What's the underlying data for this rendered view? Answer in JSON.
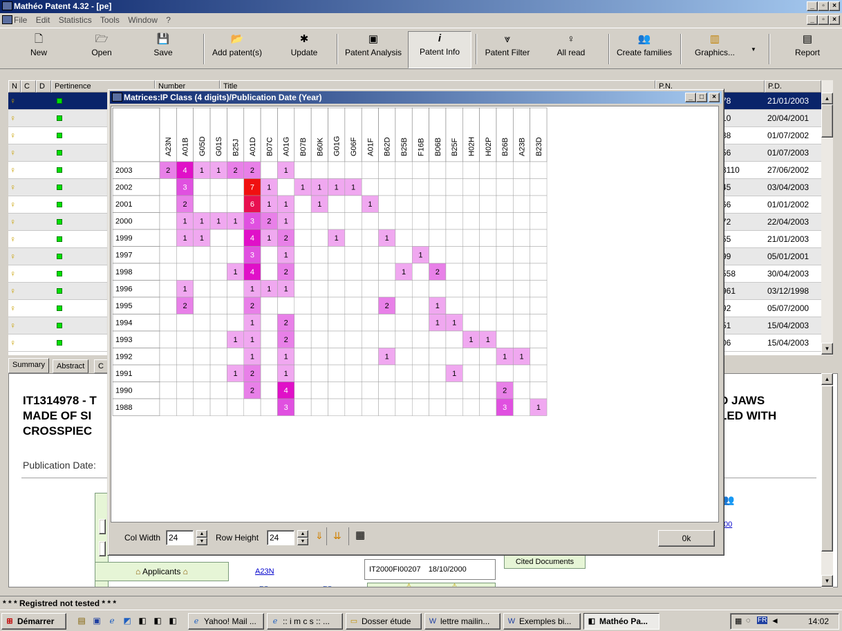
{
  "window": {
    "title": "Mathéo Patent 4.32 - [pe]"
  },
  "menu": [
    "File",
    "Edit",
    "Statistics",
    "Tools",
    "Window",
    "?"
  ],
  "toolbar": [
    {
      "label": "New",
      "icon": "new-file-icon",
      "glyph": "🗋"
    },
    {
      "label": "Open",
      "icon": "open-folder-icon",
      "glyph": "🗁"
    },
    {
      "label": "Save",
      "icon": "save-disk-icon",
      "glyph": "💾"
    },
    {
      "label": "Add patent(s)",
      "icon": "add-patent-icon",
      "glyph": "📂"
    },
    {
      "label": "Update",
      "icon": "update-icon",
      "glyph": "✱"
    },
    {
      "label": "Patent Analysis",
      "icon": "patent-analysis-icon",
      "glyph": "▣"
    },
    {
      "label": "Patent Info",
      "icon": "info-icon",
      "glyph": "i"
    },
    {
      "label": "Patent Filter",
      "icon": "filter-icon",
      "glyph": "⩔"
    },
    {
      "label": "All read",
      "icon": "bulb-icon",
      "glyph": "♀"
    },
    {
      "label": "Create families",
      "icon": "families-icon",
      "glyph": "👥"
    },
    {
      "label": "Graphics...",
      "icon": "chart-icon",
      "glyph": "▥"
    },
    {
      "label": "Report",
      "icon": "report-icon",
      "glyph": "▤"
    }
  ],
  "list": {
    "headers": [
      "N",
      "C",
      "D",
      "Pertinence",
      "Number",
      "Title",
      "P.N.",
      "P.D."
    ],
    "rows": [
      {
        "pn": "78",
        "pd": "21/01/2003"
      },
      {
        "pn": "10",
        "pd": "20/04/2001"
      },
      {
        "pn": "88",
        "pd": "01/07/2002"
      },
      {
        "pn": "56",
        "pd": "01/07/2003"
      },
      {
        "pn": "8110",
        "pd": "27/06/2002"
      },
      {
        "pn": "45",
        "pd": "03/04/2003"
      },
      {
        "pn": "66",
        "pd": "01/01/2002"
      },
      {
        "pn": "72",
        "pd": "22/04/2003"
      },
      {
        "pn": "55",
        "pd": "21/01/2003"
      },
      {
        "pn": "99",
        "pd": "05/01/2001"
      },
      {
        "pn": "558",
        "pd": "30/04/2003"
      },
      {
        "pn": "961",
        "pd": "03/12/1998"
      },
      {
        "pn": "92",
        "pd": "05/07/2000"
      },
      {
        "pn": "51",
        "pd": "15/04/2003"
      },
      {
        "pn": "06",
        "pd": "15/04/2003"
      }
    ]
  },
  "tabs": [
    "Summary",
    "Abstract",
    "C"
  ],
  "summary": {
    "title_left_1": "IT1314978 - T",
    "title_left_2": "MADE OF SI",
    "title_left_3": "CROSSPIEC",
    "title_right_1": "D JAWS",
    "title_right_2": "LED WITH",
    "publication_label": "Publication Date:",
    "applicants_label": "Applicants",
    "class_link": "A23N",
    "appnum": "IT2000FI00207",
    "appdate": "18/10/2000",
    "cited_label": "Cited Documents",
    "fc1": "FC",
    "fc2": "FC",
    "link00": "00"
  },
  "status": "* * * Registred not tested * * *",
  "taskbar": {
    "start": "Démarrer",
    "items": [
      "Yahoo! Mail ...",
      ":: i m c s :: ...",
      "Dosser étude",
      "lettre mailin...",
      "Exemples bi...",
      "Mathéo Pa..."
    ],
    "lang": "FR",
    "time": "14:02"
  },
  "dialog": {
    "title": "Matrices:IP Class (4 digits)/Publication Date (Year)",
    "col_width_label": "Col Width",
    "col_width_value": "24",
    "row_height_label": "Row Height",
    "row_height_value": "24",
    "ok_label": "0k",
    "matrix": {
      "columns": [
        "A23N",
        "A01B",
        "G05D",
        "G01S",
        "B25J",
        "A01D",
        "B07C",
        "A01G",
        "B07B",
        "B60K",
        "G01G",
        "G06F",
        "A01F",
        "B62D",
        "B25B",
        "F16B",
        "B06B",
        "B25F",
        "H02H",
        "H02P",
        "B26B",
        "A23B",
        "B23D"
      ],
      "rows": [
        {
          "year": "2003",
          "cells": {
            "A23N": 2,
            "A01B": 4,
            "G05D": 1,
            "G01S": 1,
            "B25J": 2,
            "A01D": 2,
            "A01G": 1
          }
        },
        {
          "year": "2002",
          "cells": {
            "A01B": 3,
            "A01D": 7,
            "B07C": 1,
            "B07B": 1,
            "B60K": 1,
            "G01G": 1,
            "G06F": 1
          }
        },
        {
          "year": "2001",
          "cells": {
            "A01B": 2,
            "A01D": 6,
            "B07C": 1,
            "A01G": 1,
            "B60K": 1,
            "A01F": 1
          }
        },
        {
          "year": "2000",
          "cells": {
            "A01B": 1,
            "G05D": 1,
            "G01S": 1,
            "B25J": 1,
            "A01D": 3,
            "B07C": 2,
            "A01G": 1
          }
        },
        {
          "year": "1999",
          "cells": {
            "A01B": 1,
            "G05D": 1,
            "A01D": 4,
            "B07C": 1,
            "A01G": 2,
            "G01G": 1,
            "B62D": 1
          }
        },
        {
          "year": "1997",
          "cells": {
            "A01D": 3,
            "A01G": 1,
            "F16B": 1
          }
        },
        {
          "year": "1998",
          "cells": {
            "B25J": 1,
            "A01D": 4,
            "A01G": 2,
            "B25B": 1,
            "B06B": 2
          }
        },
        {
          "year": "1996",
          "cells": {
            "A01B": 1,
            "A01D": 1,
            "B07C": 1,
            "A01G": 1
          }
        },
        {
          "year": "1995",
          "cells": {
            "A01B": 2,
            "A01D": 2,
            "B62D": 2,
            "B06B": 1
          }
        },
        {
          "year": "1994",
          "cells": {
            "A01D": 1,
            "A01G": 2,
            "B06B": 1,
            "B25F": 1
          }
        },
        {
          "year": "1993",
          "cells": {
            "B25J": 1,
            "A01D": 1,
            "A01G": 2,
            "H02H": 1,
            "H02P": 1
          }
        },
        {
          "year": "1992",
          "cells": {
            "A01D": 1,
            "A01G": 1,
            "B62D": 1,
            "B26B": 1,
            "A23B": 1
          }
        },
        {
          "year": "1991",
          "cells": {
            "B25J": 1,
            "A01D": 2,
            "A01G": 1,
            "B25F": 1
          }
        },
        {
          "year": "1990",
          "cells": {
            "A01D": 2,
            "A01G": 4,
            "B26B": 2
          }
        },
        {
          "year": "1988",
          "cells": {
            "A01G": 3,
            "B26B": 3,
            "B23D": 1
          }
        }
      ]
    },
    "colors": {
      "1": "#f0a8f0",
      "2": "#e880e8",
      "3": "#e050e0",
      "4": "#e010c8",
      "6": "#e81050",
      "7": "#f01010"
    }
  }
}
